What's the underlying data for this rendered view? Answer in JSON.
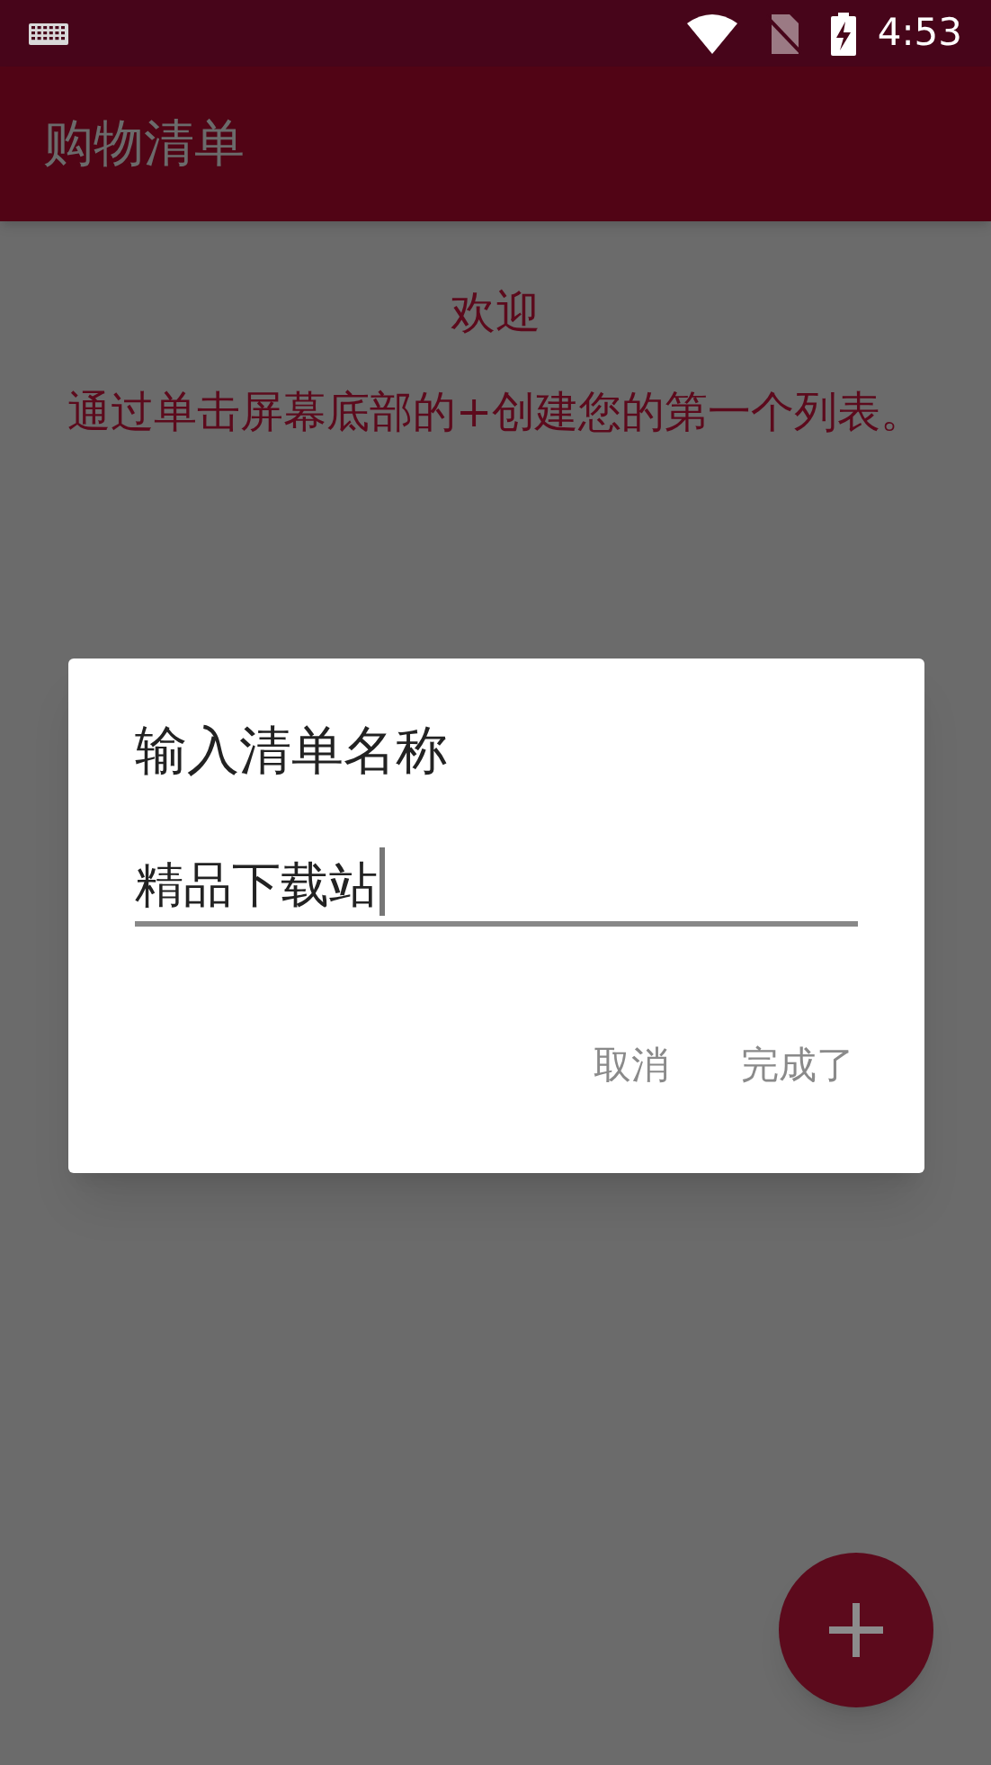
{
  "status_bar": {
    "time": "4:53"
  },
  "app_bar": {
    "title": "购物清单"
  },
  "content": {
    "heading": "欢迎",
    "message": "通过单击屏幕底部的+创建您的第一个列表。"
  },
  "dialog": {
    "title": "输入清单名称",
    "field": {
      "value": "精品下载站"
    },
    "buttons": [
      "取消",
      "完成了"
    ]
  }
}
